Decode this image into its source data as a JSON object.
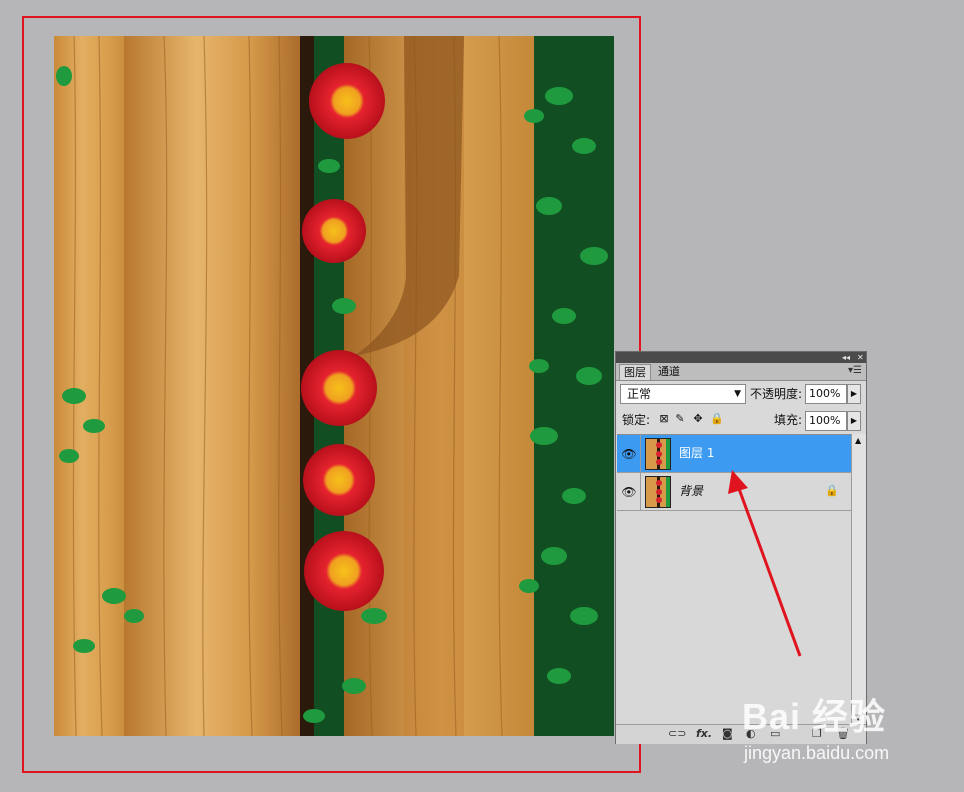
{
  "panel": {
    "tabs": [
      {
        "label": "图层",
        "active": true
      },
      {
        "label": "通道",
        "active": false
      }
    ],
    "menu_icon": "panel-menu-icon",
    "blend_mode": "正常",
    "opacity_label": "不透明度:",
    "opacity_value": "100%",
    "lock_label": "锁定:",
    "fill_label": "填充:",
    "fill_value": "100%",
    "layers": [
      {
        "name": "图层 1",
        "selected": true,
        "visible": true,
        "locked": false
      },
      {
        "name": "背景",
        "selected": false,
        "visible": true,
        "locked": true
      }
    ],
    "bottom_icons": [
      "link-icon",
      "fx-icon",
      "mask-icon",
      "adjustment-icon",
      "group-icon",
      "new-layer-icon",
      "trash-icon"
    ],
    "fx_label": "fx."
  },
  "watermark": {
    "brand": "Bai 经验",
    "url": "jingyan.baidu.com"
  },
  "colors": {
    "selection_rect": "#e0141e",
    "arrow": "#e0141e",
    "selected_layer": "#3c9bf1",
    "workspace": "#b6b5b8"
  }
}
